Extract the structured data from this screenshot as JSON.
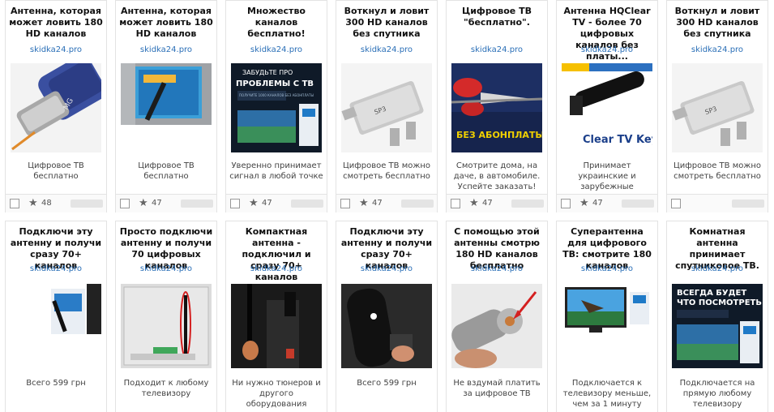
{
  "row1": [
    {
      "title": "Антенна, которая может ловить 180 HD каналов",
      "domain": "skidka24.pro",
      "desc": "Цифровое ТВ бесплатно",
      "rating": "48"
    },
    {
      "title": "Антенна, которая может ловить 180 HD каналов",
      "domain": "skidka24.pro",
      "desc": "Цифровое ТВ бесплатно",
      "rating": "47"
    },
    {
      "title": "Множество каналов бесплатно!",
      "domain": "skidka24.pro",
      "desc": "Уверенно принимает сигнал в любой точке",
      "rating": "47",
      "img_text": {
        "l1": "ЗАБУДЬТЕ ПРО",
        "l2": "ПРОБЛЕМЫ С ТВ",
        "l3": "ПОЛУЧИТЕ 1000 КАНАЛОВ БЕЗ АБОНПЛАТЫ"
      }
    },
    {
      "title": "Воткнул и ловит 300 HD каналов без спутника",
      "domain": "skidka24.pro",
      "desc": "Цифровое ТВ можно смотреть бесплатно",
      "rating": "47",
      "img_text": {
        "label": "SP3"
      }
    },
    {
      "title": "Цифровое ТВ \"бесплатно\".",
      "domain": "skidka24.pro",
      "desc": "Смотрите дома, на даче, в автомобиле. Успейте заказать!",
      "rating": "47",
      "img_text": {
        "label": "БЕЗ АБОНПЛАТЫ"
      }
    },
    {
      "title": "Антенна HQClear TV - более 70 цифровых каналов без платы...",
      "domain": "skidka24.pro",
      "desc": "Принимает украинские и зарубежные телеканалы совершенно бесплатно",
      "rating": "47",
      "img_text": {
        "label": "Clear TV Key"
      }
    },
    {
      "title": "Воткнул и ловит 300 HD каналов без спутника",
      "domain": "skidka24.pro",
      "desc": "Цифровое ТВ можно смотреть бесплатно",
      "rating": "",
      "img_text": {
        "label": "SP3"
      }
    }
  ],
  "row2": [
    {
      "title": "Подключи эту антенну и получи сразу 70+ каналов",
      "domain": "skidka24.pro",
      "desc": "Всего 599 грн"
    },
    {
      "title": "Просто подключи антенну и получи 70 цифровых каналов",
      "domain": "skidka24.pro",
      "desc": "Подходит к любому телевизору"
    },
    {
      "title": "Компактная антенна - подключил и сразу 70+ каналов",
      "domain": "skidka24.pro",
      "desc": "Ни нужно тюнеров и другого оборудования"
    },
    {
      "title": "Подключи эту антенну и получи сразу 70+ каналов",
      "domain": "skidka24.pro",
      "desc": "Всего 599 грн"
    },
    {
      "title": "С помощью этой антенны смотрю 180 HD каналов бесплатно",
      "domain": "skidka24.pro",
      "desc": "Не вздумай платить за цифровое ТВ"
    },
    {
      "title": "Суперантенна для цифрового ТВ: смотрите 180 каналов",
      "domain": "skidka24.pro",
      "desc": "Подключается к телевизору меньше, чем за 1 минуту"
    },
    {
      "title": "Комнатная антенна принимает спутниковое ТВ.",
      "domain": "skidka24.pro",
      "desc": "Подключается на прямую любому телевизору",
      "img_text": {
        "l1": "ВСЕГДА БУДЕТ",
        "l2": "ЧТО ПОСМОТРЕТЬ"
      }
    }
  ]
}
